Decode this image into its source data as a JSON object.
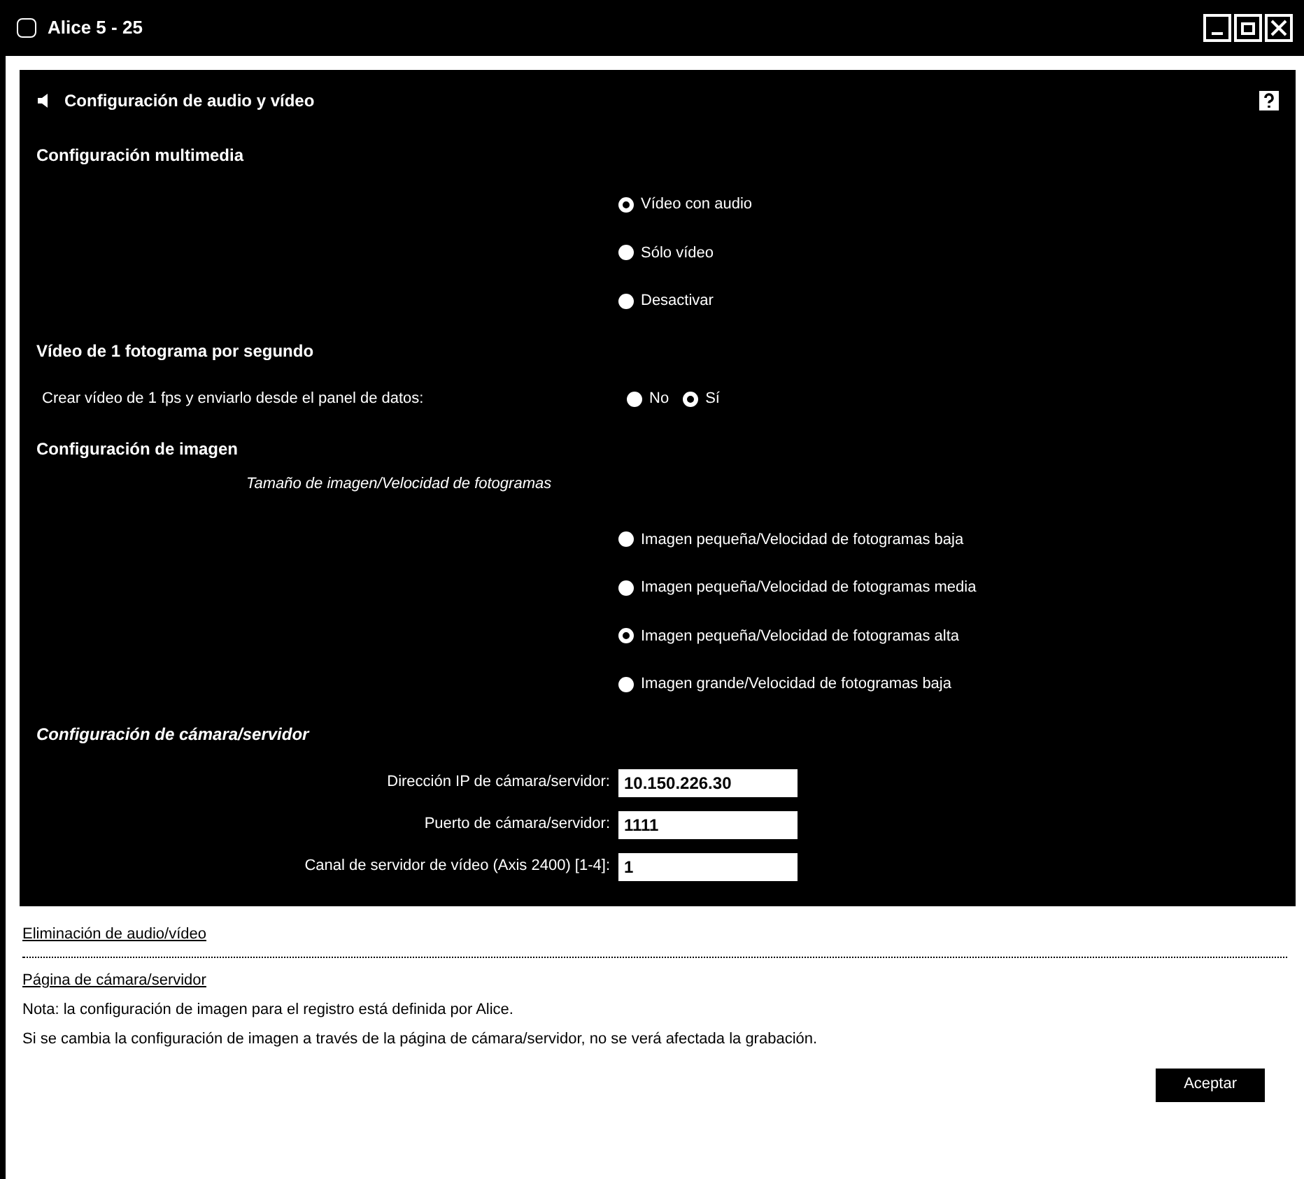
{
  "window": {
    "title": "Alice 5 - 25"
  },
  "panel": {
    "title": "Configuración de audio y vídeo"
  },
  "sections": [
    {
      "kind": "radios",
      "title": "Configuración multimedia",
      "options": [
        {
          "label": "Vídeo con audio",
          "selected": true
        },
        {
          "label": "Sólo vídeo",
          "selected": false
        },
        {
          "label": "Desactivar",
          "selected": false
        }
      ]
    },
    {
      "kind": "inline",
      "title": "Vídeo de 1 fotograma por segundo",
      "label": "Crear vídeo de 1 fps y enviarlo desde el panel de datos:",
      "options": [
        {
          "label": "No",
          "selected": false
        },
        {
          "label": "Sí",
          "selected": true
        }
      ]
    },
    {
      "kind": "radios",
      "title": "Configuración de imagen",
      "sublabel": "Tamaño de imagen/Velocidad de fotogramas",
      "options": [
        {
          "label": "Imagen pequeña/Velocidad de fotogramas baja",
          "selected": false
        },
        {
          "label": "Imagen pequeña/Velocidad de fotogramas media",
          "selected": false
        },
        {
          "label": "Imagen pequeña/Velocidad de fotogramas alta",
          "selected": true
        },
        {
          "label": "Imagen grande/Velocidad de fotogramas baja",
          "selected": false
        }
      ]
    },
    {
      "kind": "fields",
      "title": "Configuración de cámara/servidor",
      "fields": [
        {
          "label": "Dirección IP de cámara/servidor:",
          "value": "10.150.226.30"
        },
        {
          "label": "Puerto de cámara/servidor:",
          "value": "1111"
        },
        {
          "label": "Canal de servidor de vídeo (Axis 2400) [1-4]:",
          "value": "1"
        }
      ]
    }
  ],
  "links": [
    "Eliminación de audio/vídeo",
    "Página de cámara/servidor"
  ],
  "notes": [
    "Nota: la configuración de imagen para el registro está definida por Alice.",
    "Si se cambia la configuración de imagen a través de la página de cámara/servidor, no se verá afectada la grabación."
  ],
  "button": "Aceptar"
}
